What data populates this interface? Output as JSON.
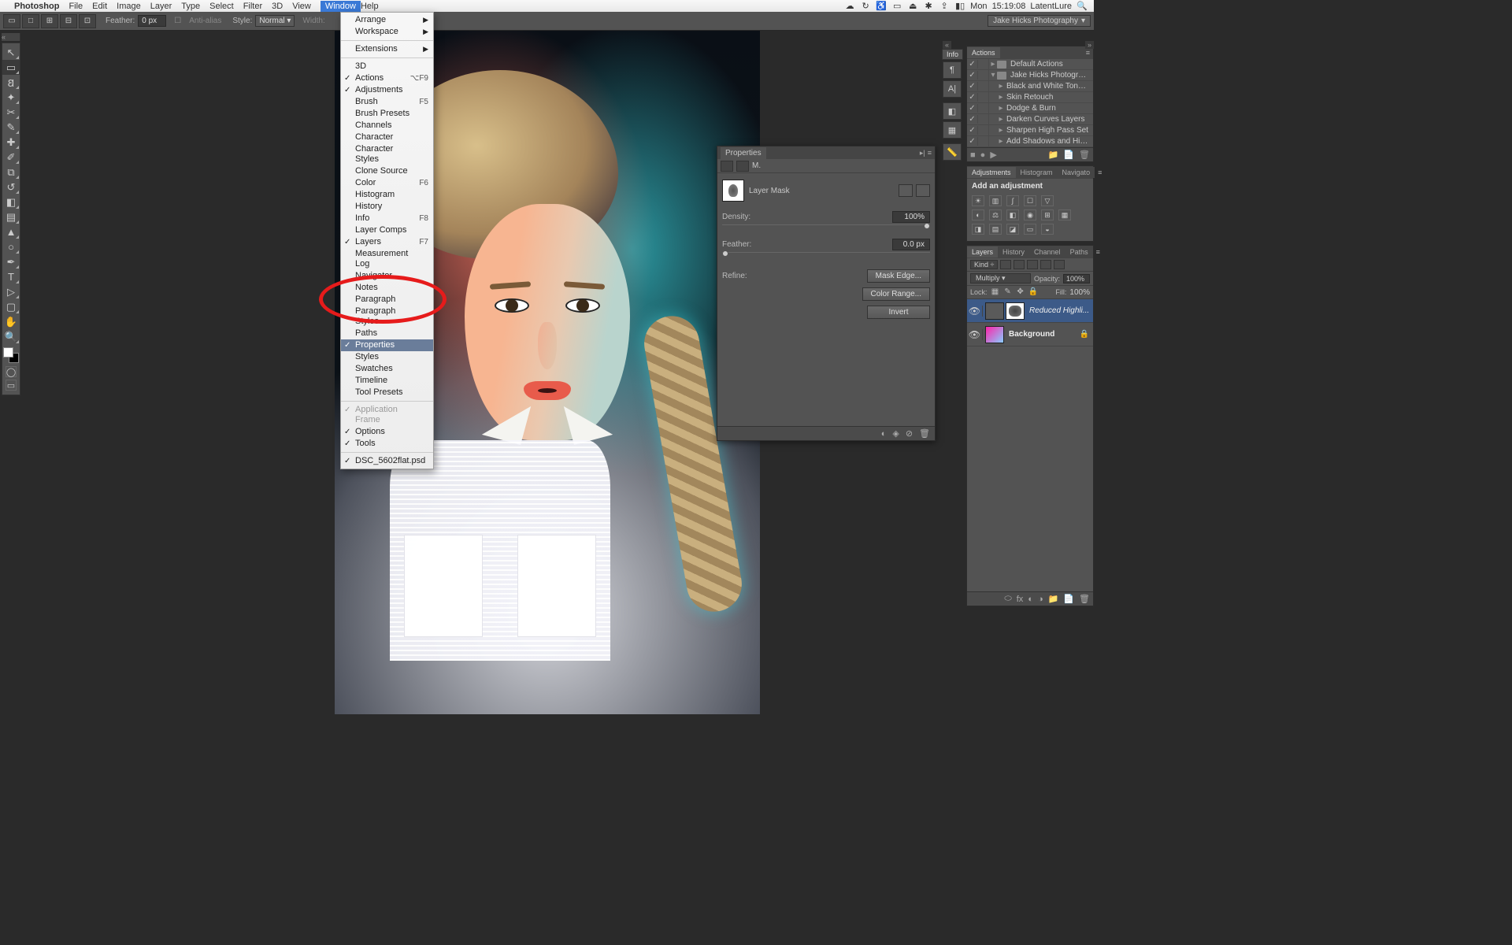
{
  "menubar": {
    "app": "Photoshop",
    "items": [
      "File",
      "Edit",
      "Image",
      "Layer",
      "Type",
      "Select",
      "Filter",
      "3D",
      "View",
      "Window",
      "Help"
    ],
    "active": "Window",
    "right": {
      "day": "Mon",
      "time": "15:19:08",
      "user": "LatentLure"
    }
  },
  "options_bar": {
    "feather_label": "Feather:",
    "feather_value": "0 px",
    "antialias_label": "Anti-alias",
    "style_label": "Style:",
    "style_value": "Normal",
    "width_label": "Width:",
    "right_label": "Jake Hicks Photography"
  },
  "window_menu": [
    {
      "label": "Arrange",
      "arrow": true
    },
    {
      "label": "Workspace",
      "arrow": true
    },
    {
      "sep": true
    },
    {
      "label": "Extensions",
      "arrow": true
    },
    {
      "sep": true
    },
    {
      "label": "3D"
    },
    {
      "label": "Actions",
      "shortcut": "⌥F9",
      "checked": true
    },
    {
      "label": "Adjustments",
      "checked": true
    },
    {
      "label": "Brush",
      "shortcut": "F5"
    },
    {
      "label": "Brush Presets"
    },
    {
      "label": "Channels"
    },
    {
      "label": "Character"
    },
    {
      "label": "Character Styles"
    },
    {
      "label": "Clone Source"
    },
    {
      "label": "Color",
      "shortcut": "F6"
    },
    {
      "label": "Histogram"
    },
    {
      "label": "History"
    },
    {
      "label": "Info",
      "shortcut": "F8"
    },
    {
      "label": "Layer Comps"
    },
    {
      "label": "Layers",
      "shortcut": "F7",
      "checked": true
    },
    {
      "label": "Measurement Log"
    },
    {
      "label": "Navigator"
    },
    {
      "label": "Notes"
    },
    {
      "label": "Paragraph"
    },
    {
      "label": "Paragraph Styles"
    },
    {
      "label": "Paths"
    },
    {
      "label": "Properties",
      "checked": true,
      "highlighted": true
    },
    {
      "label": "Styles"
    },
    {
      "label": "Swatches"
    },
    {
      "label": "Timeline"
    },
    {
      "label": "Tool Presets"
    },
    {
      "sep": true
    },
    {
      "label": "Application Frame",
      "checked": true,
      "disabled": true
    },
    {
      "label": "Options",
      "checked": true
    },
    {
      "label": "Tools",
      "checked": true
    },
    {
      "sep": true
    },
    {
      "label": "DSC_5602flat.psd",
      "checked": true
    }
  ],
  "info_tab": "Info",
  "actions_panel": {
    "tab": "Actions",
    "rows": [
      {
        "indent": 0,
        "toggle": "▸",
        "folder": true,
        "name": "Default Actions"
      },
      {
        "indent": 0,
        "toggle": "▾",
        "folder": true,
        "name": "Jake Hicks Photography ..."
      },
      {
        "indent": 1,
        "toggle": "▸",
        "name": "Black and White Tone Pr..."
      },
      {
        "indent": 1,
        "toggle": "▸",
        "name": "Skin Retouch"
      },
      {
        "indent": 1,
        "toggle": "▸",
        "name": "Dodge & Burn"
      },
      {
        "indent": 1,
        "toggle": "▸",
        "name": "Darken Curves Layers"
      },
      {
        "indent": 1,
        "toggle": "▸",
        "name": "Sharpen High Pass Set"
      },
      {
        "indent": 1,
        "toggle": "▸",
        "name": "Add Shadows and Highli..."
      }
    ]
  },
  "adjustments_panel": {
    "tabs": [
      "Adjustments",
      "Histogram",
      "Navigato"
    ],
    "hint": "Add an adjustment"
  },
  "layers_panel": {
    "tabs": [
      "Layers",
      "History",
      "Channel",
      "Paths"
    ],
    "kind_label": "Kind",
    "blend_mode": "Multiply",
    "opacity_label": "Opacity:",
    "opacity_value": "100%",
    "lock_label": "Lock:",
    "fill_label": "Fill:",
    "fill_value": "100%",
    "rows": [
      {
        "selected": true,
        "curves": true,
        "mask": true,
        "name": "Reduced Highli..."
      },
      {
        "bg": true,
        "name": "Background",
        "locked": true
      }
    ]
  },
  "properties_panel": {
    "title": "Properties",
    "mask_label": "M.",
    "type_label": "Layer Mask",
    "density_label": "Density:",
    "density_value": "100%",
    "feather_label": "Feather:",
    "feather_value": "0.0 px",
    "refine_label": "Refine:",
    "btn_mask_edge": "Mask Edge...",
    "btn_color_range": "Color Range...",
    "btn_invert": "Invert"
  }
}
